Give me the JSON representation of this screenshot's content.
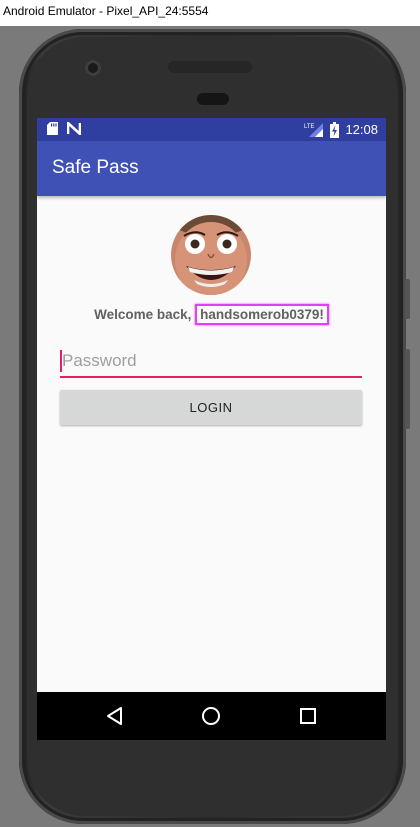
{
  "window": {
    "title": "Android Emulator - Pixel_API_24:5554"
  },
  "status_bar": {
    "time": "12:08",
    "signal_label": "LTE",
    "left_icons": [
      "sd-card-icon",
      "n-notification-icon"
    ],
    "right_icons": [
      "lte-signal-icon",
      "battery-charging-icon"
    ]
  },
  "app": {
    "title": "Safe Pass"
  },
  "main": {
    "welcome_prefix": "Welcome back, ",
    "username": "handsomerob0379!",
    "password_placeholder": "Password",
    "password_value": "",
    "login_label": "LOGIN"
  },
  "nav_bar": {
    "icons": [
      "back-icon",
      "home-icon",
      "recents-icon"
    ]
  },
  "colors": {
    "primary": "#3f51b5",
    "primary_dark": "#303f9f",
    "accent": "#e91e63",
    "highlight": "#e040fb"
  }
}
